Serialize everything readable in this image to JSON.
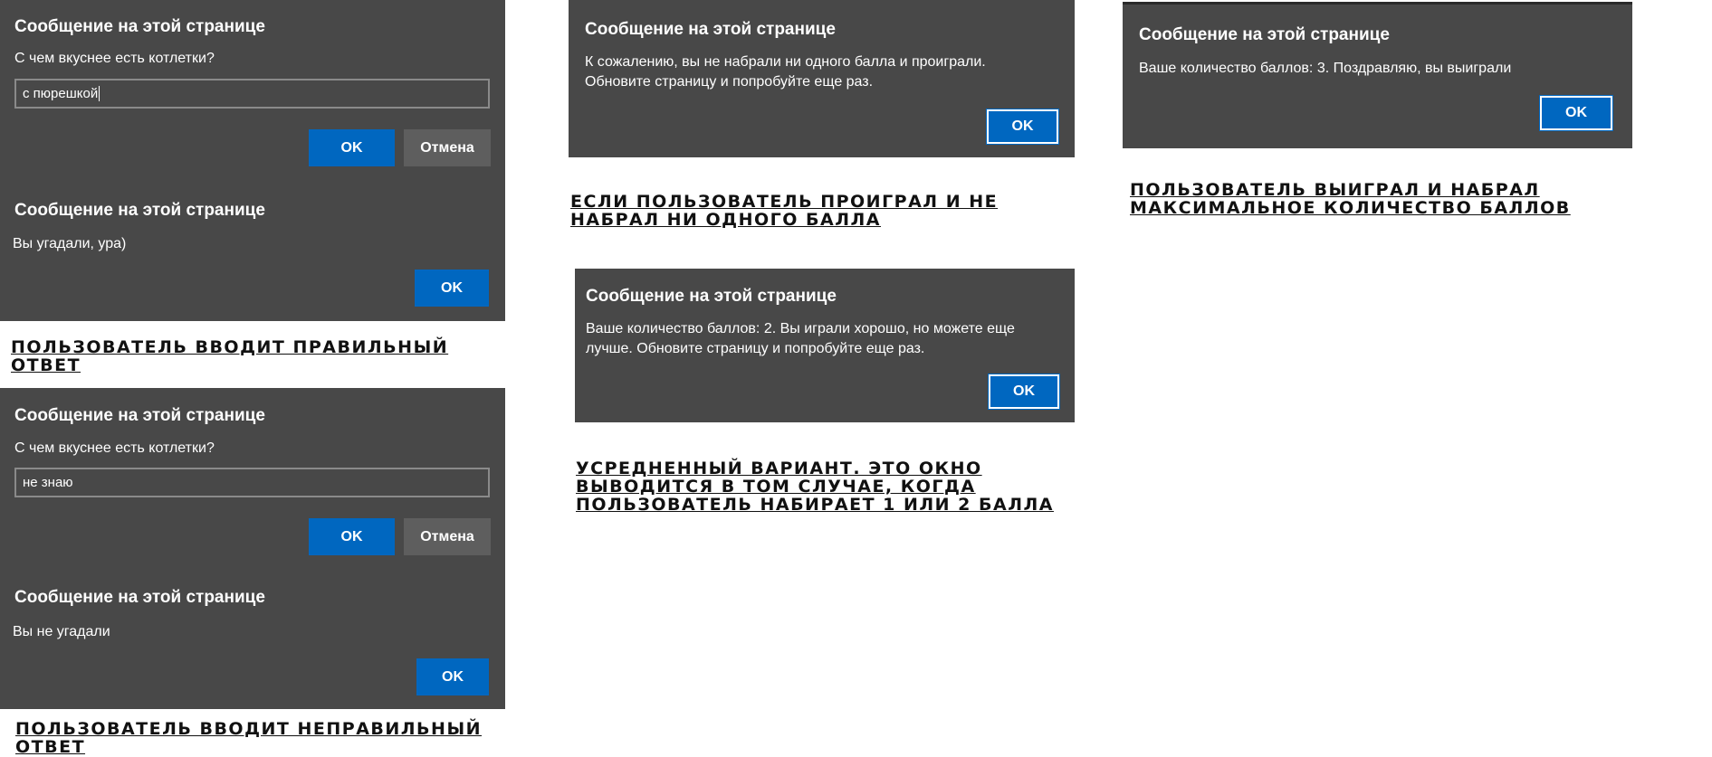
{
  "dialog_title": "Сообщение на этой странице",
  "colors": {
    "dialog_bg": "#484848",
    "ok_button": "#0067c0",
    "cancel_button": "#5e5e5e",
    "caption": "#111111"
  },
  "left_column": {
    "prompt_correct": {
      "question": "С чем вкуснее есть котлетки?",
      "input_value": "с пюрешкой",
      "ok": "OK",
      "cancel": "Отмена"
    },
    "alert_correct": {
      "message": "Вы угадали, ура)",
      "ok": "OK"
    },
    "caption_correct": "Пользователь вводит правильный ответ",
    "prompt_wrong": {
      "question": "С чем вкуснее есть котлетки?",
      "input_value": "не знаю",
      "ok": "OK",
      "cancel": "Отмена"
    },
    "alert_wrong": {
      "message": "Вы не угадали",
      "ok": "OK"
    },
    "caption_wrong": "Пользователь вводит неправильный ответ"
  },
  "middle_column": {
    "alert_zero": {
      "message_line1": "К сожалению, вы не набрали ни одного балла и проиграли.",
      "message_line2": "Обновите страницу и попробуйте еще раз.",
      "ok": "OK"
    },
    "caption_zero": "Если пользователь проиграл и не набрал ни одного балла",
    "alert_mid": {
      "message_line1": "Ваше количество баллов: 2. Вы играли хорошо, но можете еще",
      "message_line2": "лучше. Обновите страницу и попробуйте еще раз.",
      "ok": "OK"
    },
    "caption_mid": "Усредненный вариант. Это окно выводится в том случае, когда пользователь набирает 1 или 2 балла"
  },
  "right_column": {
    "alert_max": {
      "message": "Ваше количество баллов: 3. Поздравляю, вы выиграли",
      "ok": "OK"
    },
    "caption_max": "Пользователь выиграл и набрал максимальное количество баллов"
  }
}
